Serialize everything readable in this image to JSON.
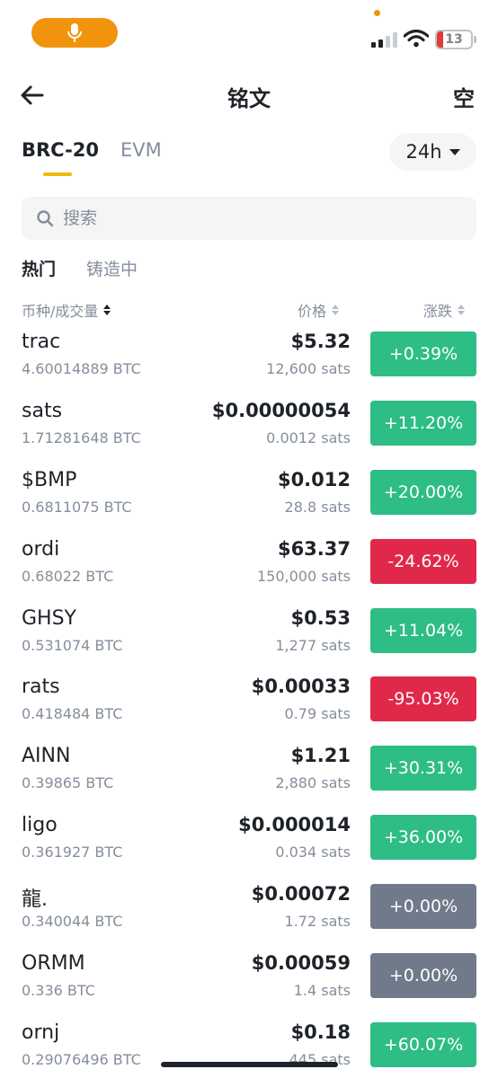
{
  "status_bar": {
    "battery": "13",
    "signal_bars": 2,
    "colors": {
      "mic_pill": "#f1930d",
      "battery_low": "#e23a3a"
    },
    "icons": [
      "microphone-icon",
      "signal-icon",
      "wifi-icon",
      "battery-icon"
    ]
  },
  "header": {
    "title": "铭文",
    "right_label": "空"
  },
  "tabs": [
    {
      "label": "BRC-20",
      "active": true
    },
    {
      "label": "EVM",
      "active": false
    }
  ],
  "period": {
    "value": "24h"
  },
  "search": {
    "placeholder": "搜索"
  },
  "subtabs": [
    {
      "label": "热门",
      "active": true
    },
    {
      "label": "铸造中",
      "active": false
    }
  ],
  "columns": {
    "name_volume": "币种/成交量",
    "price": "价格",
    "change": "涨跌"
  },
  "colors": {
    "accent": "#f0b90b",
    "up": "#2ebd85",
    "down": "#e0294a",
    "flat": "#707a8a"
  },
  "rows": [
    {
      "name": "trac",
      "volume": "4.60014889 BTC",
      "price": "$5.32",
      "sats": "12,600 sats",
      "change": "+0.39%",
      "trend": "up"
    },
    {
      "name": "sats",
      "volume": "1.71281648 BTC",
      "price": "$0.00000054",
      "sats": "0.0012 sats",
      "change": "+11.20%",
      "trend": "up"
    },
    {
      "name": "$BMP",
      "volume": "0.6811075 BTC",
      "price": "$0.012",
      "sats": "28.8 sats",
      "change": "+20.00%",
      "trend": "up"
    },
    {
      "name": "ordi",
      "volume": "0.68022 BTC",
      "price": "$63.37",
      "sats": "150,000 sats",
      "change": "-24.62%",
      "trend": "down"
    },
    {
      "name": "GHSY",
      "volume": "0.531074 BTC",
      "price": "$0.53",
      "sats": "1,277 sats",
      "change": "+11.04%",
      "trend": "up"
    },
    {
      "name": "rats",
      "volume": "0.418484 BTC",
      "price": "$0.00033",
      "sats": "0.79 sats",
      "change": "-95.03%",
      "trend": "down"
    },
    {
      "name": "AINN",
      "volume": "0.39865 BTC",
      "price": "$1.21",
      "sats": "2,880 sats",
      "change": "+30.31%",
      "trend": "up"
    },
    {
      "name": "ligo",
      "volume": "0.361927 BTC",
      "price": "$0.000014",
      "sats": "0.034 sats",
      "change": "+36.00%",
      "trend": "up"
    },
    {
      "name": "龍.",
      "volume": "0.340044 BTC",
      "price": "$0.00072",
      "sats": "1.72 sats",
      "change": "+0.00%",
      "trend": "flat"
    },
    {
      "name": "ORMM",
      "volume": "0.336 BTC",
      "price": "$0.00059",
      "sats": "1.4 sats",
      "change": "+0.00%",
      "trend": "flat"
    },
    {
      "name": "ornj",
      "volume": "0.29076496 BTC",
      "price": "$0.18",
      "sats": "445 sats",
      "change": "+60.07%",
      "trend": "up"
    }
  ]
}
